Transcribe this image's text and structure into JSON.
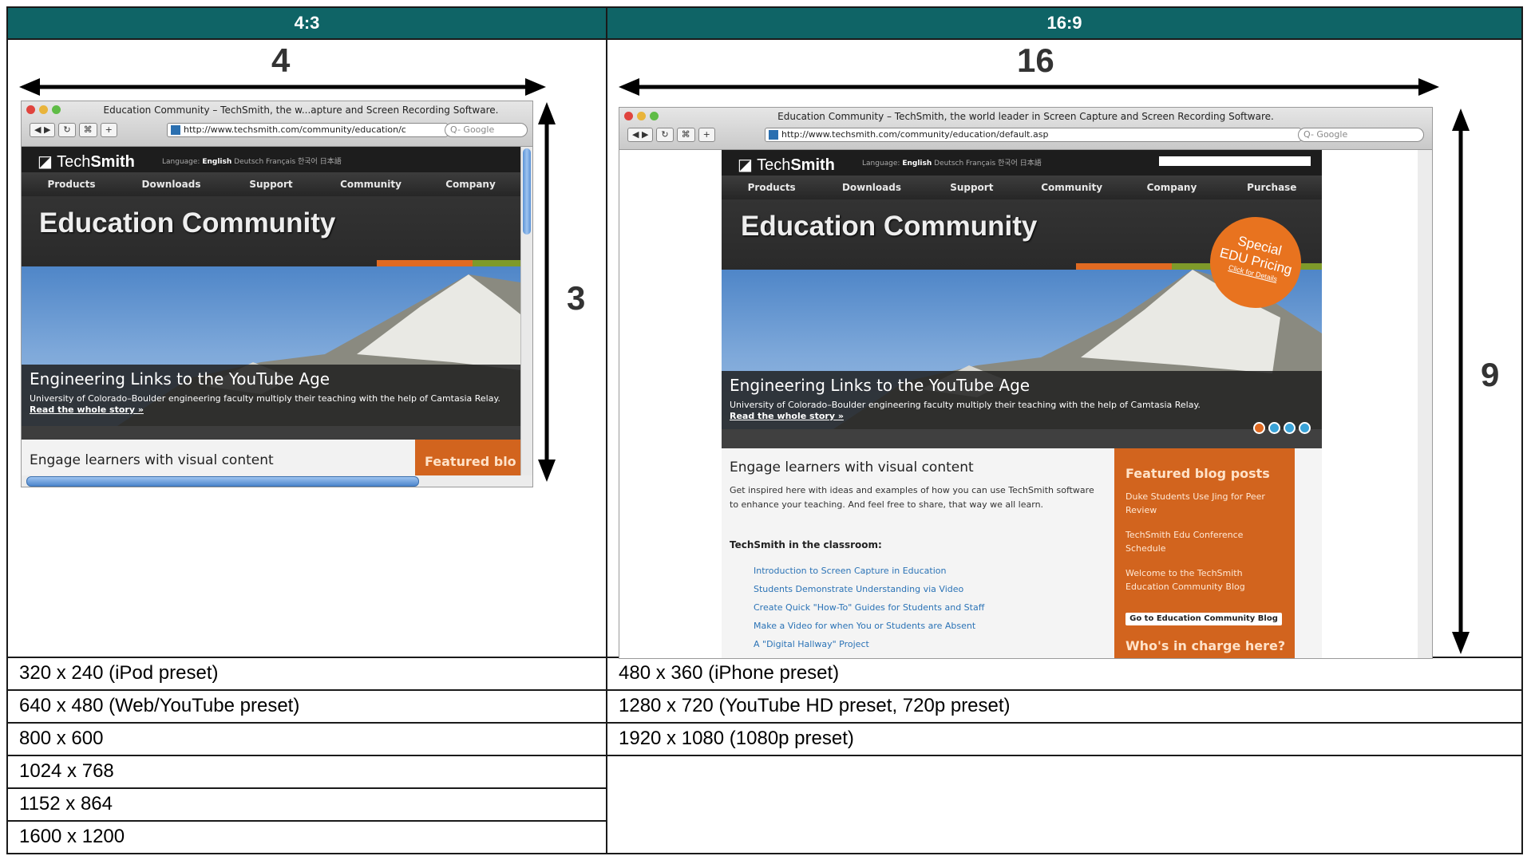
{
  "table": {
    "headers": [
      "4:3",
      "16:9"
    ],
    "col1_rows": [
      "320 x 240 (iPod preset)",
      "640 x 480 (Web/YouTube preset)",
      "800 x 600",
      "1024 x 768",
      "1152 x 864",
      "1600 x 1200"
    ],
    "col2_rows": [
      "480 x 360 (iPhone preset)",
      "1280 x 720 (YouTube HD preset, 720p preset)",
      "1920 x 1080 (1080p preset)"
    ]
  },
  "left": {
    "width_label": "4",
    "height_label": "3",
    "window_title": "Education Community – TechSmith, the w...apture and Screen Recording Software.",
    "url": "http://www.techsmith.com/community/education/c",
    "search_placeholder": "Q- Google",
    "nav": [
      "Products",
      "Downloads",
      "Support",
      "Community",
      "Company"
    ],
    "banner_title": "Education Community",
    "story_title": "Engineering Links to the YouTube Age",
    "story_text": "University of Colorado–Boulder engineering faculty multiply their teaching with the help of Camtasia Relay.",
    "story_link": "Read the whole story »",
    "engage": "Engage learners with visual content",
    "featured": "Featured blo"
  },
  "right": {
    "width_label": "16",
    "height_label": "9",
    "window_title": "Education Community – TechSmith, the world leader in Screen Capture and Screen Recording Software.",
    "url": "http://www.techsmith.com/community/education/default.asp",
    "search_placeholder": "Q- Google",
    "nav": [
      "Products",
      "Downloads",
      "Support",
      "Community",
      "Company",
      "Purchase"
    ],
    "banner_title": "Education Community",
    "badge": [
      "Special",
      "EDU Pricing",
      "Click for Details"
    ],
    "story_title": "Engineering Links to the YouTube Age",
    "story_text": "University of Colorado–Boulder engineering faculty multiply their teaching with the help of Camtasia Relay.",
    "story_link": "Read the whole story »",
    "engage": "Engage learners with visual content",
    "engage_text": "Get inspired here with ideas and examples of how you can use TechSmith software to enhance your teaching. And feel free to share, that way we all learn.",
    "classroom_title": "TechSmith in the classroom:",
    "classroom_links": [
      "Introduction to Screen Capture in Education",
      "Students Demonstrate Understanding via Video",
      "Create Quick \"How-To\" Guides for Students and Staff",
      "Make a Video for when You or Students are Absent",
      "A \"Digital Hallway\" Project"
    ],
    "featured_title": "Featured blog posts",
    "featured_items": [
      "Duke Students Use Jing for Peer Review",
      "TechSmith Edu Conference Schedule",
      "Welcome to the TechSmith Education Community Blog"
    ],
    "blog_button": "Go to Education Community Blog",
    "who": "Who's in charge here?"
  },
  "site": {
    "logo_light": "Tech",
    "logo_bold": "Smith",
    "language_label": "Language:",
    "language_current": "English",
    "language_others": "Deutsch  Français  한국어  日本語"
  }
}
